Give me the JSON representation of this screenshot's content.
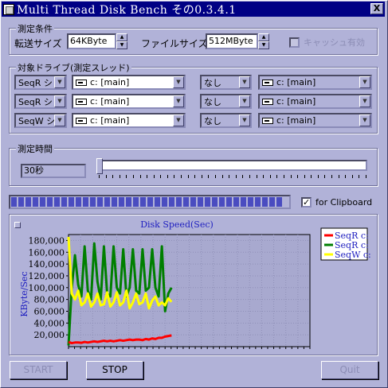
{
  "window": {
    "title": "Multi Thread Disk Bench その0.3.4.1",
    "close_label": "X"
  },
  "measure_conditions": {
    "legend": "測定条件",
    "transfer_size_label": "転送サイズ",
    "transfer_size_value": "64KByte",
    "file_size_label": "ファイルサイズ",
    "file_size_value": "512MByte",
    "cache_label": "キャッシュ有効"
  },
  "target_drives": {
    "legend": "対象ドライブ(測定スレッド)",
    "rows": [
      {
        "mode": "SeqR シ",
        "drive": "c: [main]",
        "option": "なし",
        "drive2": "c: [main]"
      },
      {
        "mode": "SeqR シ",
        "drive": "c: [main]",
        "option": "なし",
        "drive2": "c: [main]"
      },
      {
        "mode": "SeqW シ",
        "drive": "c: [main]",
        "option": "なし",
        "drive2": "c: [main]"
      }
    ]
  },
  "measure_time": {
    "legend": "測定時間",
    "value": "30秒"
  },
  "progress": {
    "segments": 38
  },
  "clipboard": {
    "label": "for Clipboard",
    "checked": true
  },
  "chart_data": {
    "type": "line",
    "title": "Disk Speed(Sec)",
    "ylabel": "KByte/Sec",
    "xlabel": "",
    "ylim": [
      0,
      190000
    ],
    "xlim": [
      0,
      30
    ],
    "y_ticks": [
      "180,000",
      "160,000",
      "140,000",
      "120,000",
      "100,000",
      "80,000",
      "60,000",
      "40,000",
      "20,000"
    ],
    "grid": true,
    "legend_position": "top-right",
    "series": [
      {
        "name": "SeqR c:",
        "color": "#ff0000",
        "x": [
          0,
          1,
          2,
          3,
          4,
          5,
          6,
          7,
          8,
          9,
          10,
          11,
          12,
          13,
          14,
          15,
          16,
          17,
          18,
          19,
          20,
          21,
          22,
          23,
          24,
          25,
          26,
          27,
          28,
          29,
          30,
          31,
          32
        ],
        "values": [
          8000,
          6000,
          7000,
          7000,
          6500,
          8000,
          7000,
          8000,
          9000,
          8000,
          9000,
          10000,
          9000,
          10000,
          9000,
          10000,
          11000,
          10000,
          11000,
          12000,
          11000,
          12000,
          12000,
          11000,
          13000,
          12000,
          14000,
          13000,
          15000,
          15000,
          17000,
          18000,
          19000
        ]
      },
      {
        "name": "SeqR c:",
        "color": "#007f00",
        "x": [
          0,
          1,
          2,
          3,
          4,
          5,
          6,
          7,
          8,
          9,
          10,
          11,
          12,
          13,
          14,
          15,
          16,
          17,
          18,
          19,
          20,
          21,
          22,
          23,
          24,
          25,
          26,
          27,
          28,
          29,
          30,
          31,
          32
        ],
        "values": [
          2000,
          100000,
          155000,
          105000,
          85000,
          170000,
          95000,
          80000,
          175000,
          110000,
          80000,
          170000,
          90000,
          85000,
          170000,
          100000,
          90000,
          165000,
          85000,
          100000,
          165000,
          95000,
          90000,
          165000,
          95000,
          100000,
          165000,
          100000,
          85000,
          170000,
          60000,
          90000,
          100000
        ]
      },
      {
        "name": "SeqW c:",
        "color": "#ffff00",
        "x": [
          0,
          1,
          2,
          3,
          4,
          5,
          6,
          7,
          8,
          9,
          10,
          11,
          12,
          13,
          14,
          15,
          16,
          17,
          18,
          19,
          20,
          21,
          22,
          23,
          24,
          25,
          26,
          27,
          28,
          29,
          30,
          31,
          32
        ],
        "values": [
          186000,
          90000,
          80000,
          95000,
          70000,
          75000,
          90000,
          68000,
          75000,
          90000,
          70000,
          72000,
          92000,
          68000,
          75000,
          92000,
          70000,
          75000,
          95000,
          65000,
          75000,
          90000,
          72000,
          75000,
          90000,
          65000,
          78000,
          85000,
          70000,
          75000,
          70000,
          82000,
          76000
        ]
      }
    ]
  },
  "buttons": {
    "start": "START",
    "stop": "STOP",
    "quit": "Quit"
  },
  "colors": {
    "face": "#b1b2d8",
    "title_bar": "#000084",
    "progress": "#4a4cc0",
    "plot_bg": "#a8a9cf"
  }
}
